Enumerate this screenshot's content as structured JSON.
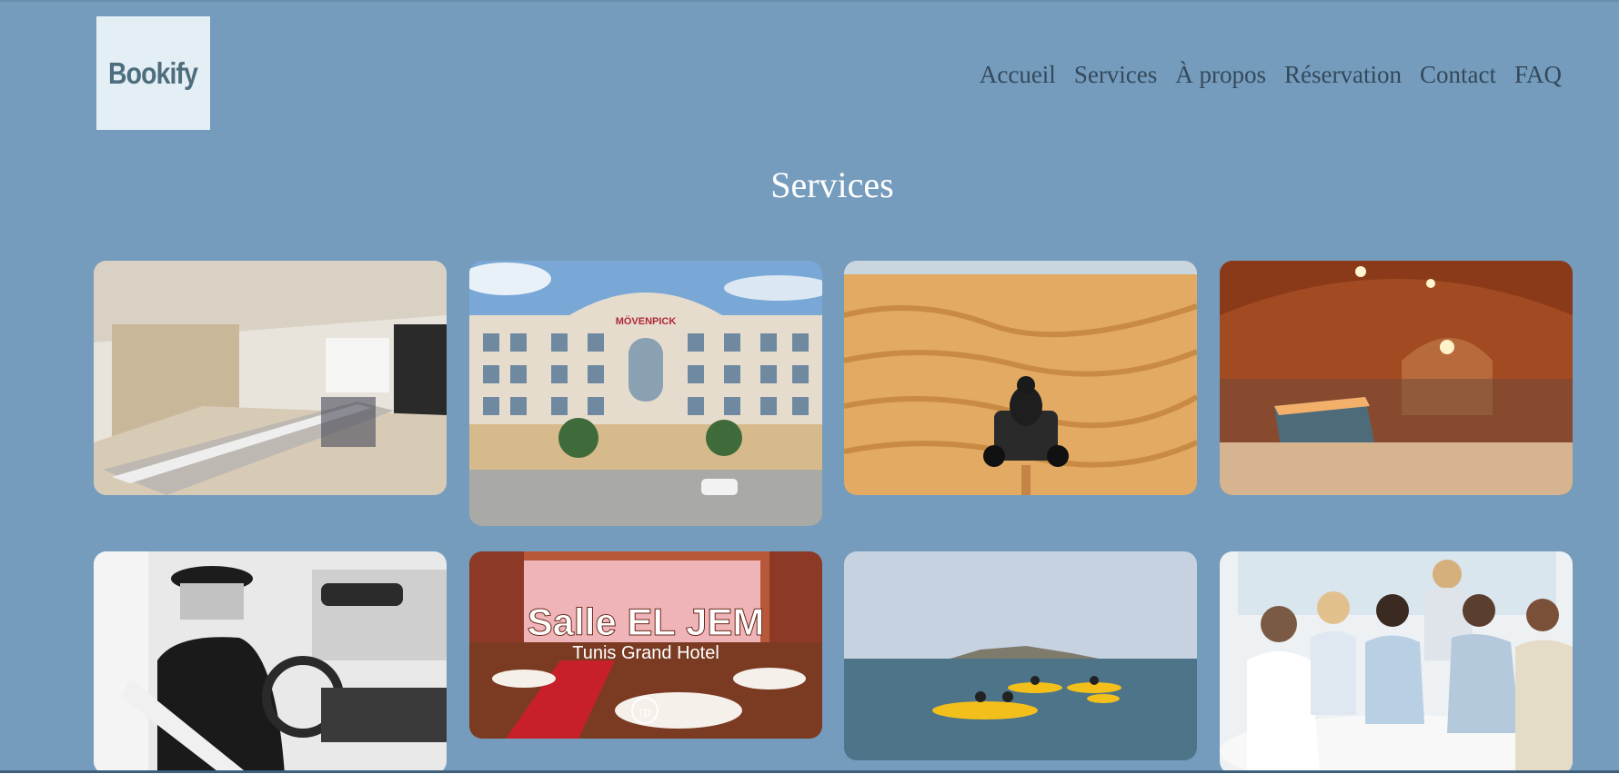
{
  "logo": {
    "text": "Bookify"
  },
  "nav": {
    "items": [
      "Accueil",
      "Services",
      "À propos",
      "Réservation",
      "Contact",
      "FAQ"
    ]
  },
  "section": {
    "title": "Services"
  },
  "cards": [
    {
      "name": "conference-room",
      "overlay": ""
    },
    {
      "name": "movenpick-hotel",
      "overlay": "MÖVENPICK"
    },
    {
      "name": "desert-quad",
      "overlay": ""
    },
    {
      "name": "hammam-spa",
      "overlay": ""
    },
    {
      "name": "private-driver",
      "overlay": ""
    },
    {
      "name": "salle-el-jem",
      "overlay": "Salle EL JEM",
      "overlay_sub": "Tunis Grand Hotel",
      "overlay_badge": "rp"
    },
    {
      "name": "kayak-sea",
      "overlay": ""
    },
    {
      "name": "business-meeting",
      "overlay": ""
    }
  ],
  "colors": {
    "page_bg": "#759cbd",
    "nav_text": "#34495b",
    "logo_bg": "#e3eef5",
    "logo_text": "#4e6e7e"
  }
}
